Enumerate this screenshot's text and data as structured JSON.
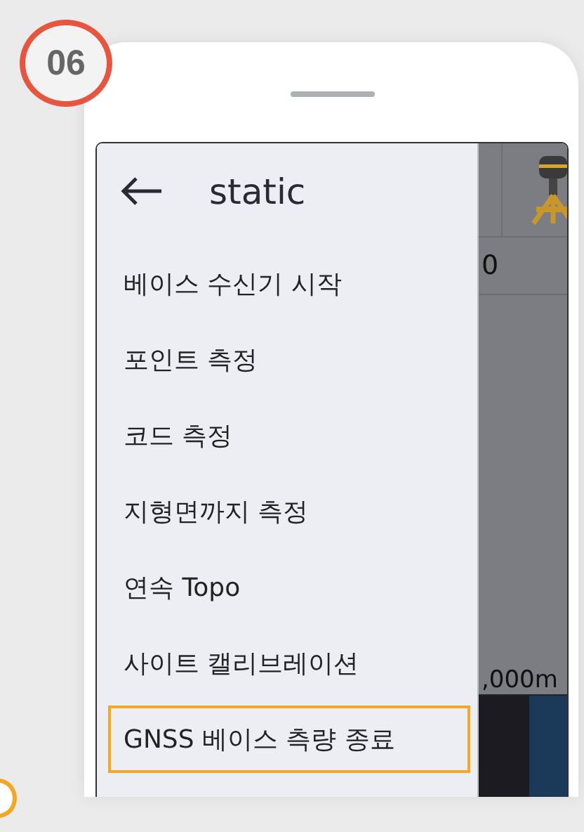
{
  "step_badge": "06",
  "drawer": {
    "title": "static",
    "items": [
      {
        "label": "베이스 수신기 시작",
        "highlighted": false
      },
      {
        "label": "포인트 측정",
        "highlighted": false
      },
      {
        "label": "코드 측정",
        "highlighted": false
      },
      {
        "label": "지형면까지 측정",
        "highlighted": false
      },
      {
        "label": "연속 Topo",
        "highlighted": false
      },
      {
        "label": "사이트 캘리브레이션",
        "highlighted": false
      },
      {
        "label": "GNSS 베이스 측량 종료",
        "highlighted": true
      }
    ]
  },
  "map": {
    "top_value": "0",
    "scale_label": ",000m"
  }
}
